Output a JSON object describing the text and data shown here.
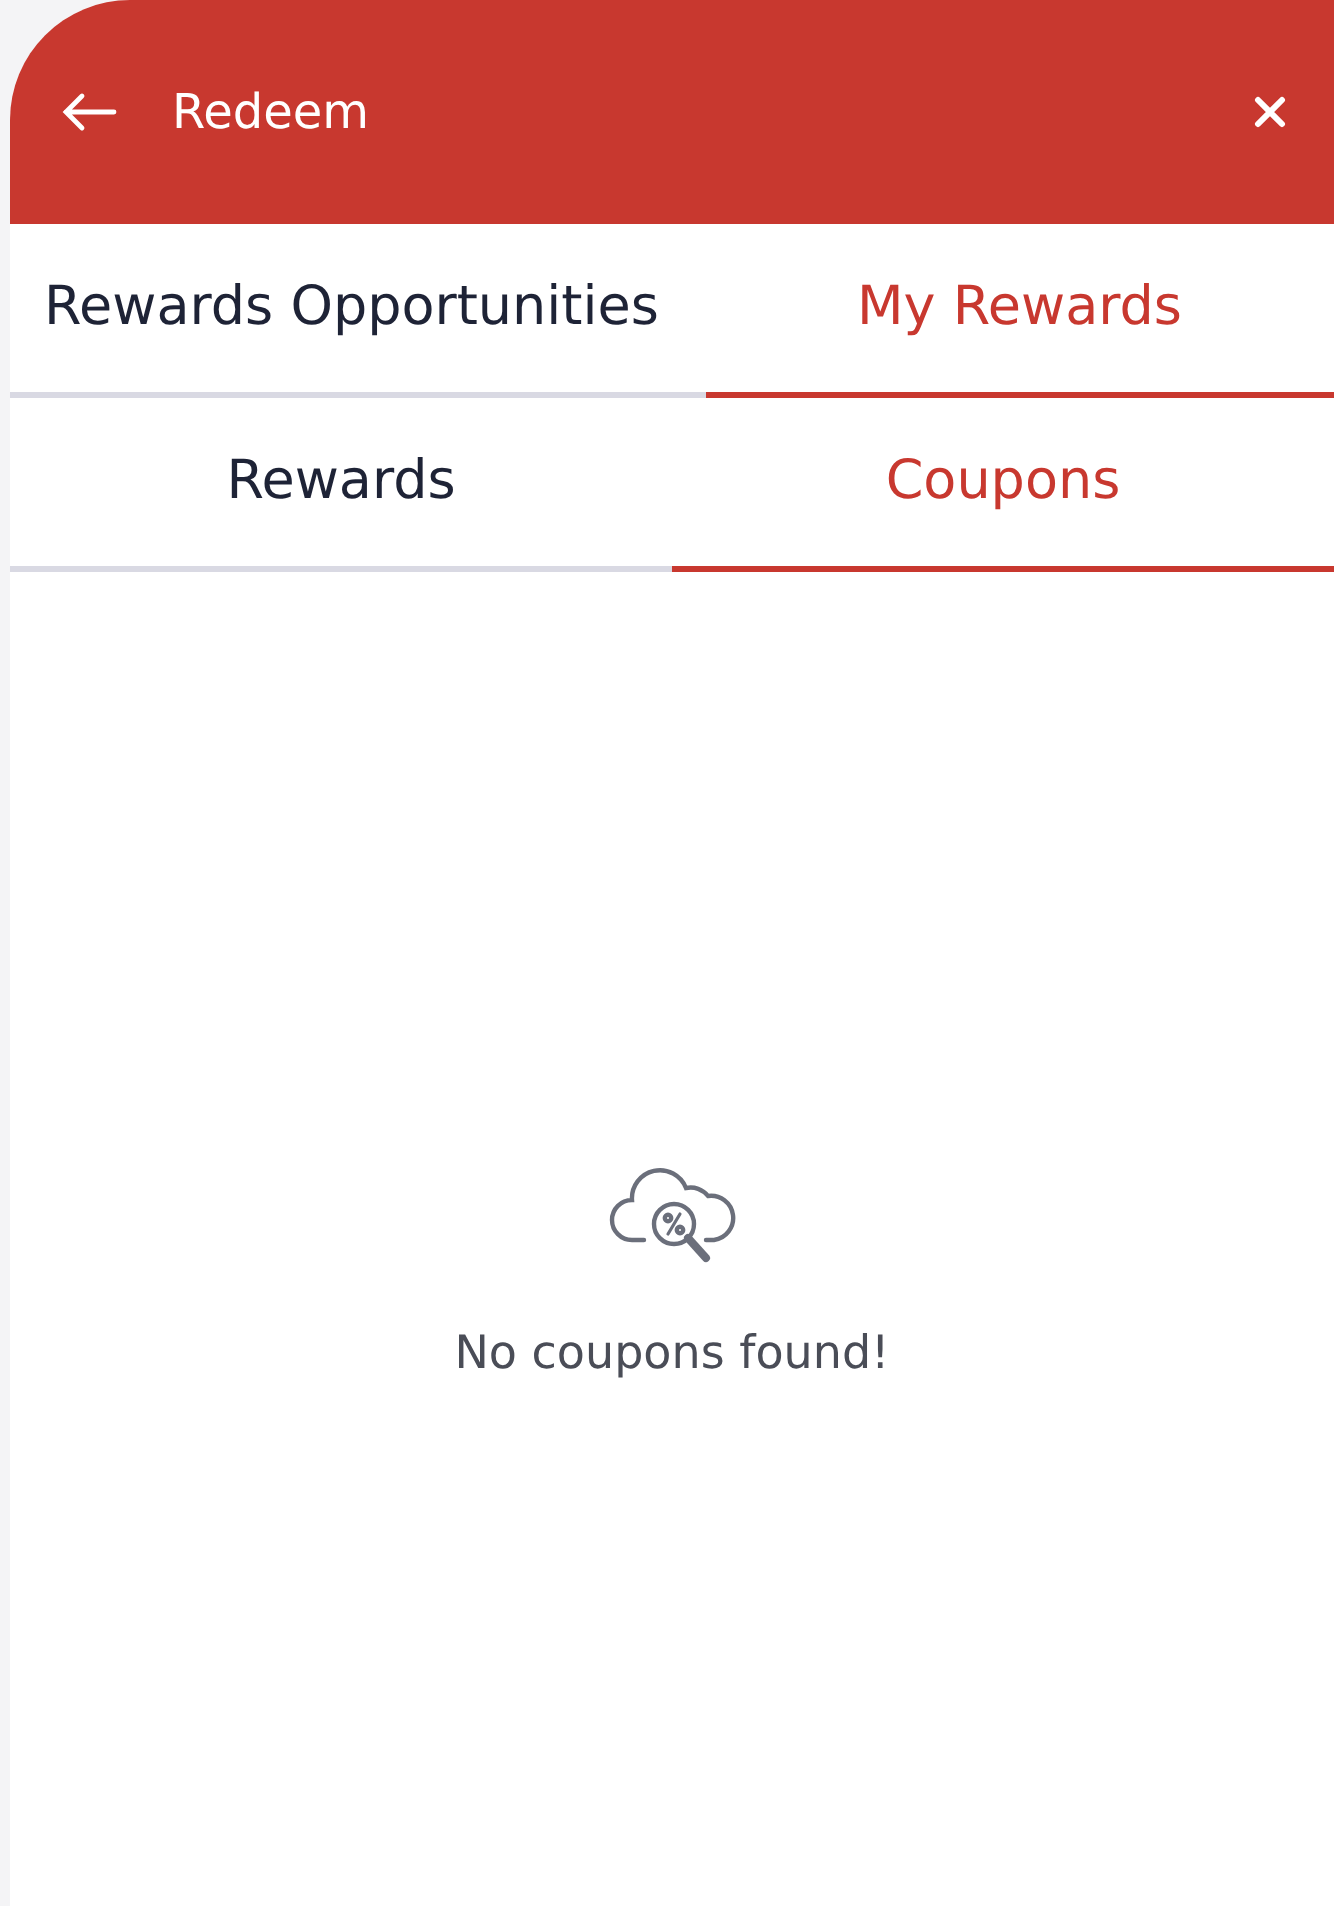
{
  "header": {
    "title": "Redeem"
  },
  "tabs": [
    {
      "label": "Rewards Opportunities",
      "selected": false
    },
    {
      "label": "My Rewards",
      "selected": true
    }
  ],
  "subtabs": [
    {
      "label": "Rewards",
      "selected": false
    },
    {
      "label": "Coupons",
      "selected": true
    }
  ],
  "empty_state": {
    "message": "No coupons found!"
  }
}
